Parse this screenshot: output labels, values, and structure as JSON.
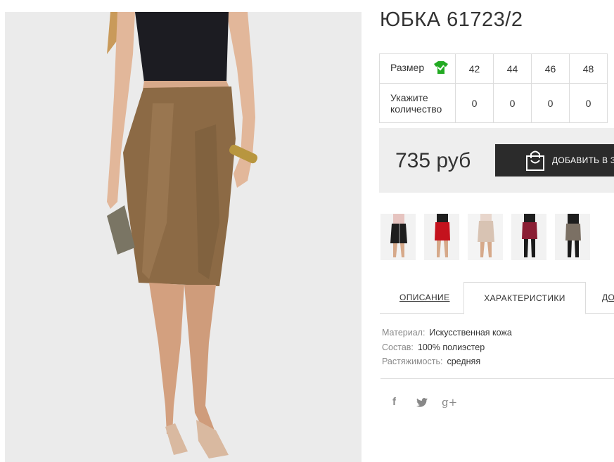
{
  "product": {
    "title": "ЮБКА 61723/2",
    "photo_icon": "model-photo"
  },
  "sizes": {
    "size_label": "Размер",
    "size_icon": "shirt-check-icon",
    "size_icon_color": "#22aa22",
    "quantity_label_line1": "Укажите",
    "quantity_label_line2": "количество",
    "values": [
      "42",
      "44",
      "46",
      "48"
    ],
    "quantities": [
      "0",
      "0",
      "0",
      "0"
    ]
  },
  "purchase": {
    "price": "735 руб",
    "add_label": "ДОБАВИТЬ В З",
    "add_icon": "shopping-bag-icon"
  },
  "thumbnails": [
    {
      "name": "black-zip-skirt"
    },
    {
      "name": "red-leather-skirt"
    },
    {
      "name": "beige-skirt"
    },
    {
      "name": "burgundy-skirt"
    },
    {
      "name": "gray-skirt"
    }
  ],
  "tabs": {
    "description": "ОПИСАНИЕ",
    "characteristics": "ХАРАКТЕРИСТИКИ",
    "more": "ДО"
  },
  "specs": [
    {
      "key": "Материал:",
      "value": "Искусственная кожа"
    },
    {
      "key": "Состав:",
      "value": "100% полиэстер"
    },
    {
      "key": "Растяжимость:",
      "value": "средняя"
    }
  ],
  "social": {
    "facebook": "f",
    "twitter": "twitter-icon",
    "google": "g+"
  }
}
